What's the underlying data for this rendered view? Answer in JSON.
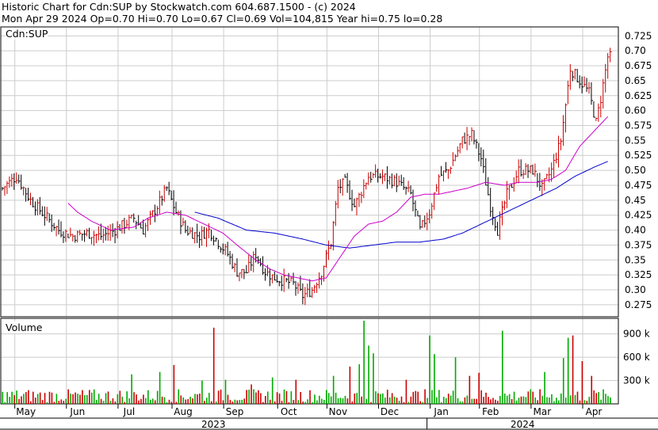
{
  "header": {
    "line1": "Historic Chart for Cdn:SUP by Stockwatch.com 604.687.1500 - (c) 2024",
    "line2": "Mon Apr 29 2024  Op=0.70  Hi=0.70  Lo=0.67  Cl=0.69  Vol=104,815  Year hi=0.75  lo=0.28"
  },
  "colors": {
    "up_bar": "#cc0000",
    "down_bar": "#000000",
    "ma_short": "#cc00cc",
    "ma_long": "#0000cc",
    "vol_up": "#00aa00",
    "vol_down": "#cc0000",
    "grid": "#cccccc"
  },
  "chart_data": [
    {
      "type": "line",
      "name": "price",
      "label": "Cdn:SUP",
      "ylim": [
        0.255,
        0.74
      ],
      "yticks": [
        "0.725",
        "0.70",
        "0.675",
        "0.65",
        "0.625",
        "0.60",
        "0.575",
        "0.55",
        "0.525",
        "0.50",
        "0.475",
        "0.45",
        "0.425",
        "0.40",
        "0.375",
        "0.35",
        "0.325",
        "0.30",
        "0.275"
      ],
      "months": [
        "May",
        "Jun",
        "Jul",
        "Aug",
        "Sep",
        "Oct",
        "Nov",
        "Dec",
        "Jan",
        "Feb",
        "Mar",
        "Apr"
      ],
      "years": [
        "2023",
        "2024"
      ],
      "close_anchors": [
        [
          0,
          0.47
        ],
        [
          6,
          0.49
        ],
        [
          12,
          0.45
        ],
        [
          18,
          0.425
        ],
        [
          24,
          0.4
        ],
        [
          30,
          0.39
        ],
        [
          36,
          0.395
        ],
        [
          42,
          0.39
        ],
        [
          48,
          0.4
        ],
        [
          52,
          0.41
        ],
        [
          56,
          0.42
        ],
        [
          60,
          0.4
        ],
        [
          66,
          0.44
        ],
        [
          70,
          0.47
        ],
        [
          74,
          0.43
        ],
        [
          78,
          0.4
        ],
        [
          84,
          0.39
        ],
        [
          88,
          0.4
        ],
        [
          92,
          0.38
        ],
        [
          96,
          0.36
        ],
        [
          100,
          0.33
        ],
        [
          104,
          0.33
        ],
        [
          108,
          0.36
        ],
        [
          112,
          0.33
        ],
        [
          116,
          0.32
        ],
        [
          120,
          0.315
        ],
        [
          124,
          0.31
        ],
        [
          128,
          0.29
        ],
        [
          132,
          0.3
        ],
        [
          136,
          0.33
        ],
        [
          140,
          0.38
        ],
        [
          143,
          0.47
        ],
        [
          146,
          0.48
        ],
        [
          150,
          0.44
        ],
        [
          156,
          0.49
        ],
        [
          162,
          0.49
        ],
        [
          168,
          0.48
        ],
        [
          174,
          0.46
        ],
        [
          178,
          0.4
        ],
        [
          182,
          0.43
        ],
        [
          186,
          0.49
        ],
        [
          190,
          0.5
        ],
        [
          196,
          0.55
        ],
        [
          200,
          0.56
        ],
        [
          204,
          0.52
        ],
        [
          208,
          0.44
        ],
        [
          211,
          0.4
        ],
        [
          215,
          0.46
        ],
        [
          220,
          0.5
        ],
        [
          226,
          0.5
        ],
        [
          230,
          0.47
        ],
        [
          234,
          0.5
        ],
        [
          238,
          0.55
        ],
        [
          242,
          0.67
        ],
        [
          246,
          0.65
        ],
        [
          250,
          0.63
        ],
        [
          253,
          0.58
        ],
        [
          255,
          0.62
        ],
        [
          258,
          0.69
        ]
      ],
      "ma_short_anchors": [
        [
          28,
          0.445
        ],
        [
          32,
          0.43
        ],
        [
          38,
          0.415
        ],
        [
          46,
          0.4
        ],
        [
          56,
          0.405
        ],
        [
          62,
          0.42
        ],
        [
          70,
          0.43
        ],
        [
          78,
          0.425
        ],
        [
          86,
          0.41
        ],
        [
          94,
          0.395
        ],
        [
          100,
          0.375
        ],
        [
          108,
          0.35
        ],
        [
          114,
          0.335
        ],
        [
          120,
          0.325
        ],
        [
          126,
          0.32
        ],
        [
          132,
          0.315
        ],
        [
          138,
          0.32
        ],
        [
          144,
          0.355
        ],
        [
          150,
          0.39
        ],
        [
          156,
          0.41
        ],
        [
          162,
          0.415
        ],
        [
          168,
          0.43
        ],
        [
          174,
          0.455
        ],
        [
          180,
          0.46
        ],
        [
          186,
          0.46
        ],
        [
          192,
          0.465
        ],
        [
          198,
          0.47
        ],
        [
          206,
          0.48
        ],
        [
          214,
          0.475
        ],
        [
          220,
          0.48
        ],
        [
          228,
          0.48
        ],
        [
          234,
          0.485
        ],
        [
          240,
          0.5
        ],
        [
          246,
          0.54
        ],
        [
          252,
          0.565
        ],
        [
          258,
          0.59
        ]
      ],
      "ma_long_anchors": [
        [
          82,
          0.43
        ],
        [
          92,
          0.42
        ],
        [
          104,
          0.4
        ],
        [
          116,
          0.395
        ],
        [
          128,
          0.385
        ],
        [
          138,
          0.375
        ],
        [
          148,
          0.37
        ],
        [
          158,
          0.375
        ],
        [
          168,
          0.38
        ],
        [
          178,
          0.38
        ],
        [
          188,
          0.385
        ],
        [
          196,
          0.395
        ],
        [
          204,
          0.41
        ],
        [
          212,
          0.425
        ],
        [
          220,
          0.44
        ],
        [
          228,
          0.455
        ],
        [
          236,
          0.47
        ],
        [
          244,
          0.49
        ],
        [
          252,
          0.505
        ],
        [
          258,
          0.515
        ]
      ]
    },
    {
      "type": "bar",
      "name": "volume",
      "label": "Volume",
      "ylim": [
        0,
        1100000
      ],
      "yticks": [
        "900 k",
        "600 k",
        "300 k"
      ],
      "spikes": [
        [
          55,
          380000
        ],
        [
          67,
          410000
        ],
        [
          73,
          500000
        ],
        [
          85,
          300000
        ],
        [
          90,
          980000
        ],
        [
          95,
          310000
        ],
        [
          106,
          250000
        ],
        [
          115,
          340000
        ],
        [
          125,
          310000
        ],
        [
          141,
          360000
        ],
        [
          148,
          480000
        ],
        [
          152,
          510000
        ],
        [
          154,
          1070000
        ],
        [
          156,
          750000
        ],
        [
          158,
          650000
        ],
        [
          172,
          310000
        ],
        [
          182,
          880000
        ],
        [
          184,
          640000
        ],
        [
          193,
          600000
        ],
        [
          199,
          360000
        ],
        [
          203,
          400000
        ],
        [
          213,
          940000
        ],
        [
          231,
          410000
        ],
        [
          239,
          590000
        ],
        [
          241,
          850000
        ],
        [
          243,
          880000
        ],
        [
          247,
          550000
        ],
        [
          251,
          360000
        ]
      ]
    }
  ]
}
